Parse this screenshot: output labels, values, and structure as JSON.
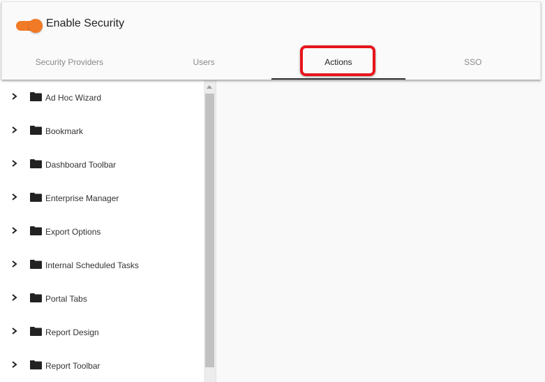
{
  "header": {
    "toggle": {
      "label": "Enable Security",
      "on": true,
      "color": "#f07a26"
    }
  },
  "tabs": [
    {
      "label": "Security Providers",
      "active": false
    },
    {
      "label": "Users",
      "active": false
    },
    {
      "label": "Actions",
      "active": true
    },
    {
      "label": "SSO",
      "active": false
    }
  ],
  "annotation": {
    "highlight_color": "#e8141b",
    "target": "Actions"
  },
  "tree": {
    "items": [
      {
        "label": "Ad Hoc Wizard",
        "icon": "folder-icon",
        "expander": "chevron-right-icon"
      },
      {
        "label": "Bookmark",
        "icon": "folder-icon",
        "expander": "chevron-right-icon"
      },
      {
        "label": "Dashboard Toolbar",
        "icon": "folder-icon",
        "expander": "chevron-right-icon"
      },
      {
        "label": "Enterprise Manager",
        "icon": "folder-icon",
        "expander": "chevron-right-icon"
      },
      {
        "label": "Export Options",
        "icon": "folder-icon",
        "expander": "chevron-right-icon"
      },
      {
        "label": "Internal Scheduled Tasks",
        "icon": "folder-icon",
        "expander": "chevron-right-icon"
      },
      {
        "label": "Portal Tabs",
        "icon": "folder-icon",
        "expander": "chevron-right-icon"
      },
      {
        "label": "Report Design",
        "icon": "folder-icon",
        "expander": "chevron-right-icon"
      },
      {
        "label": "Report Toolbar",
        "icon": "folder-icon",
        "expander": "chevron-right-icon"
      }
    ]
  }
}
